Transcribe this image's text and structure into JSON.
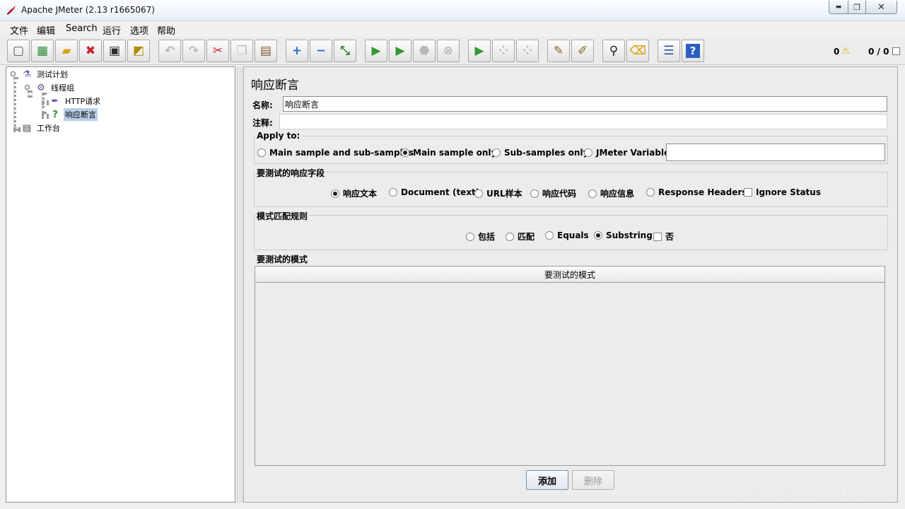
{
  "window": {
    "title": "Apache JMeter (2.13 r1665067)",
    "min_glyph": "▬",
    "max_glyph": "❐",
    "close_glyph": "✕"
  },
  "menu": [
    "文件",
    "编辑",
    "Search",
    "运行",
    "选项",
    "帮助"
  ],
  "toolbar": {
    "buttons": [
      {
        "icon": "new-icon",
        "glyph": "▢",
        "color": "#555555",
        "enabled": true
      },
      {
        "icon": "templates-icon",
        "glyph": "▦",
        "color": "#2f8a3a",
        "enabled": true
      },
      {
        "icon": "open-icon",
        "glyph": "▰",
        "color": "#d9a21b",
        "enabled": true
      },
      {
        "icon": "close-icon",
        "glyph": "✖",
        "color": "#c8232c",
        "enabled": true
      },
      {
        "icon": "save-icon",
        "glyph": "▣",
        "color": "#2b2b2b",
        "enabled": true
      },
      {
        "icon": "save-as-icon",
        "glyph": "◩",
        "color": "#b28900",
        "enabled": true
      },
      {
        "icon": "undo-icon",
        "glyph": "↶",
        "color": "#b9b9b9",
        "enabled": false
      },
      {
        "icon": "redo-icon",
        "glyph": "↷",
        "color": "#b9b9b9",
        "enabled": false
      },
      {
        "icon": "cut-icon",
        "glyph": "✂",
        "color": "#c8232c",
        "enabled": true
      },
      {
        "icon": "copy-icon",
        "glyph": "❐",
        "color": "#b9b9b9",
        "enabled": false
      },
      {
        "icon": "paste-icon",
        "glyph": "▤",
        "color": "#7a5a2a",
        "enabled": true
      },
      {
        "icon": "expand-icon",
        "glyph": "+",
        "color": "#2a6fd0",
        "enabled": true
      },
      {
        "icon": "collapse-icon",
        "glyph": "−",
        "color": "#2a6fd0",
        "enabled": true
      },
      {
        "icon": "toggle-icon",
        "glyph": "⤡",
        "color": "#2f8a3a",
        "enabled": true
      },
      {
        "icon": "start-icon",
        "glyph": "▶",
        "color": "#2f9a2f",
        "enabled": true
      },
      {
        "icon": "start-no-pause-icon",
        "glyph": "▶",
        "color": "#2f9a2f",
        "enabled": true
      },
      {
        "icon": "stop-icon",
        "glyph": "⬣",
        "color": "#b9b9b9",
        "enabled": false
      },
      {
        "icon": "shutdown-icon",
        "glyph": "⊗",
        "color": "#b9b9b9",
        "enabled": false
      },
      {
        "icon": "remote-start-icon",
        "glyph": "▶",
        "color": "#2f9a2f",
        "enabled": true
      },
      {
        "icon": "remote-stop-icon",
        "glyph": "⁘",
        "color": "#b9b9b9",
        "enabled": false
      },
      {
        "icon": "remote-shutdown-icon",
        "glyph": "⁘",
        "color": "#b9b9b9",
        "enabled": false
      },
      {
        "icon": "clear-icon",
        "glyph": "✎",
        "color": "#8a6a2a",
        "enabled": true
      },
      {
        "icon": "clear-all-icon",
        "glyph": "✐",
        "color": "#8a6a2a",
        "enabled": true
      },
      {
        "icon": "search-icon",
        "glyph": "⚲",
        "color": "#1f1f1f",
        "enabled": true
      },
      {
        "icon": "reset-search-icon",
        "glyph": "⌫",
        "color": "#d9a21b",
        "enabled": true
      },
      {
        "icon": "function-helper-icon",
        "glyph": "☰",
        "color": "#2a4fa0",
        "enabled": true
      },
      {
        "icon": "help-icon",
        "glyph": "?",
        "color": "#ffffff",
        "enabled": true
      }
    ],
    "error_count": "0",
    "thread_count": "0 / 0"
  },
  "tree": {
    "items": [
      {
        "label": "测试计划",
        "icon": "test-plan-icon",
        "glyph": "⚗",
        "color": "#6d5bb5",
        "selected": false
      },
      {
        "label": "线程组",
        "icon": "thread-group-icon",
        "glyph": "⚙",
        "color": "#6a4a8a",
        "selected": false
      },
      {
        "label": "HTTP请求",
        "icon": "http-sampler-icon",
        "glyph": "✒",
        "color": "#5a4aa8",
        "selected": false
      },
      {
        "label": "响应断言",
        "icon": "assertion-icon",
        "glyph": "?",
        "color": "#2f8a3a",
        "selected": true
      },
      {
        "label": "工作台",
        "icon": "workbench-icon",
        "glyph": "▤",
        "color": "#444444",
        "selected": false
      }
    ]
  },
  "panel": {
    "title": "响应断言",
    "name_label": "名称:",
    "name_value": "响应断言",
    "comment_label": "注释:",
    "comment_value": ""
  },
  "apply_to": {
    "title": "Apply to:",
    "options": [
      "Main sample and sub-samples",
      "Main sample only",
      "Sub-samples only",
      "JMeter Variable"
    ],
    "selected": 1,
    "variable_value": ""
  },
  "response_field": {
    "title": "要测试的响应字段",
    "options": [
      "响应文本",
      "Document (text)",
      "URL样本",
      "响应代码",
      "响应信息",
      "Response Headers"
    ],
    "selected": 0,
    "ignore_status_label": "Ignore Status",
    "ignore_status_checked": false
  },
  "pattern_rules": {
    "title": "模式匹配规则",
    "options": [
      "包括",
      "匹配",
      "Equals",
      "Substring"
    ],
    "selected": 3,
    "not_label": "否",
    "not_checked": false
  },
  "patterns": {
    "title": "要测试的模式",
    "column": "要测试的模式",
    "rows": []
  },
  "buttons": {
    "add": "添加",
    "delete": "删除"
  },
  "watermark": "https://blog.csdn.net/qq_41782425"
}
